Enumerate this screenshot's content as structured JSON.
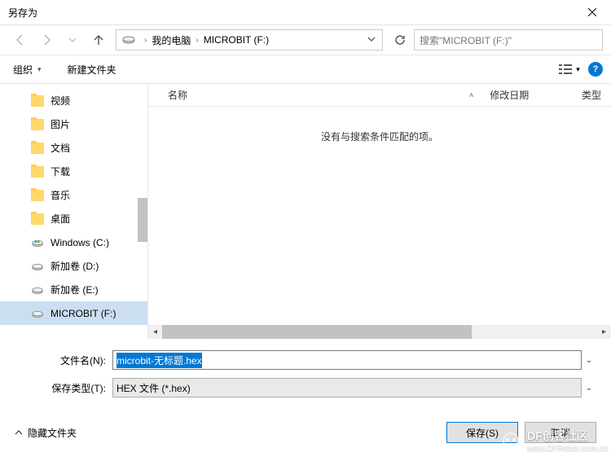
{
  "title": "另存为",
  "breadcrumb": {
    "pc": "我的电脑",
    "drive": "MICROBIT (F:)"
  },
  "search": {
    "placeholder": "搜索\"MICROBIT (F:)\""
  },
  "toolbar": {
    "organize": "组织",
    "new_folder": "新建文件夹"
  },
  "sidebar": {
    "items": [
      {
        "label": "视频",
        "type": "folder"
      },
      {
        "label": "图片",
        "type": "folder"
      },
      {
        "label": "文档",
        "type": "folder"
      },
      {
        "label": "下载",
        "type": "folder"
      },
      {
        "label": "音乐",
        "type": "folder"
      },
      {
        "label": "桌面",
        "type": "folder"
      },
      {
        "label": "Windows (C:)",
        "type": "disk-win"
      },
      {
        "label": "新加卷 (D:)",
        "type": "disk"
      },
      {
        "label": "新加卷 (E:)",
        "type": "disk"
      },
      {
        "label": "MICROBIT (F:)",
        "type": "disk",
        "selected": true
      }
    ]
  },
  "columns": {
    "name": "名称",
    "modified": "修改日期",
    "type": "类型"
  },
  "empty_text": "没有与搜索条件匹配的项。",
  "form": {
    "filename_label": "文件名(N):",
    "filename_value": "microbit-无标题.hex",
    "filetype_label": "保存类型(T):",
    "filetype_value": "HEX 文件 (*.hex)"
  },
  "footer": {
    "hide_folders": "隐藏文件夹",
    "save": "保存(S)",
    "cancel": "取消"
  },
  "watermark": {
    "title": "DF创客社区",
    "url": "www.DFRobot.com.cn"
  }
}
